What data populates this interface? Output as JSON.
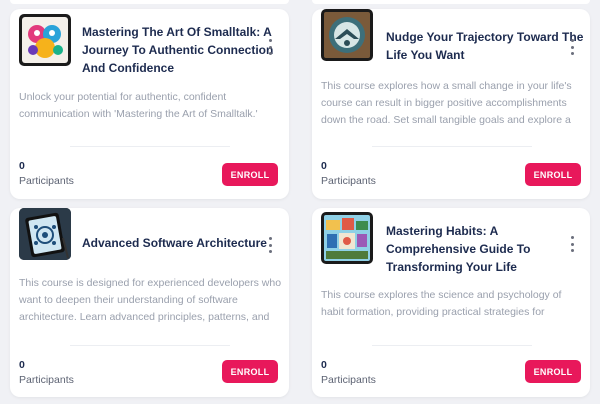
{
  "accent_color": "#e8185b",
  "courses": [
    {
      "title_lines": [
        "Mastering The Art Of Smalltalk: A",
        "Journey To Authentic Connection",
        "And Confidence"
      ],
      "description_lines": [
        "Unlock your potential for authentic, confident",
        "communication with 'Mastering the Art of Smalltalk.'"
      ],
      "participants_count": "0",
      "participants_label": "Participants",
      "enroll_label": "ENROLL",
      "thumbnail_icon": "smalltalk-art-icon"
    },
    {
      "title_lines": [
        "Nudge Your Trajectory Toward The",
        "Life You Want"
      ],
      "description_lines": [
        "This course explores how a small change in your life's",
        "course can result in bigger positive accomplishments",
        "down the road. Set small tangible goals and explore a"
      ],
      "participants_count": "0",
      "participants_label": "Participants",
      "enroll_label": "ENROLL",
      "thumbnail_icon": "emblem-icon"
    },
    {
      "title_lines": [
        "Advanced Software Architecture"
      ],
      "description_lines": [
        "This course is designed for experienced developers who",
        "want to deepen their understanding of software",
        "architecture. Learn advanced principles, patterns, and"
      ],
      "participants_count": "0",
      "participants_label": "Participants",
      "enroll_label": "ENROLL",
      "thumbnail_icon": "tablet-diagram-icon"
    },
    {
      "title_lines": [
        "Mastering Habits: A",
        "Comprehensive Guide To",
        "Transforming Your Life"
      ],
      "description_lines": [
        "This course explores the science and psychology of",
        "habit formation, providing practical strategies for"
      ],
      "participants_count": "0",
      "participants_label": "Participants",
      "enroll_label": "ENROLL",
      "thumbnail_icon": "habits-collage-icon"
    }
  ]
}
